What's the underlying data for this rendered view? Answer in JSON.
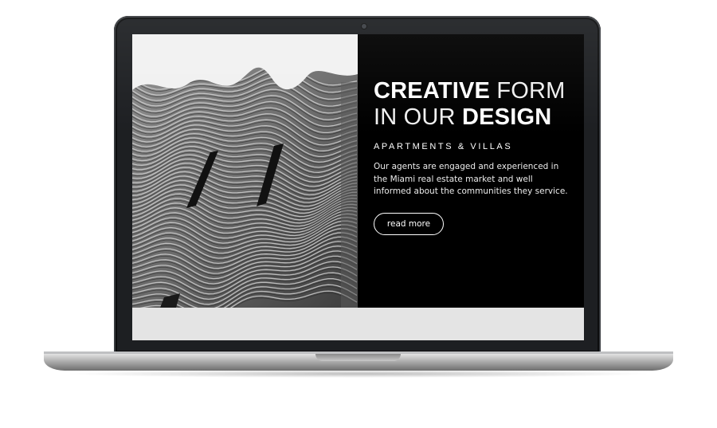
{
  "hero": {
    "headline_line1_bold": "CREATIVE",
    "headline_line1_light": "FORM",
    "headline_line2_light": "IN OUR",
    "headline_line2_bold": "DESIGN",
    "subheading": "APARTMENTS & VILLAS",
    "description": "Our agents are engaged and experienced in the Miami real estate market and well informed about the communities they service.",
    "button_label": "read more",
    "image_subject": "wavy-architecture-facade"
  },
  "colors": {
    "screen_background": "#000000",
    "text": "#ffffff",
    "footer_band": "#e4e4e4",
    "bezel": "#1d1f22"
  },
  "device": {
    "type": "laptop-mockup",
    "icons": [
      "camera-icon"
    ]
  }
}
